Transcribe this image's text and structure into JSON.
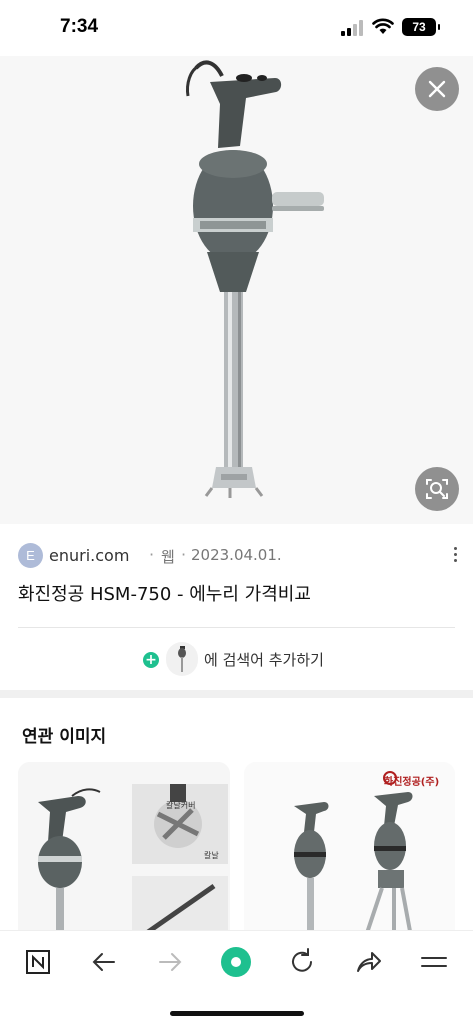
{
  "status_bar": {
    "time": "7:34",
    "battery_level": "73",
    "icons": [
      "signal-icon",
      "wifi-icon",
      "battery-icon"
    ]
  },
  "viewer": {
    "close_icon": "close-icon",
    "lens_icon": "image-search-icon"
  },
  "result": {
    "favicon_letter": "E",
    "domain": "enuri.com",
    "separator": "·",
    "type": "웹",
    "date": "2023.04.01.",
    "title": "화진정공 HSM-750 - 에누리 가격비교",
    "more_icon": "more-vertical-icon"
  },
  "add_search": {
    "label": "에 검색어 추가하기",
    "icon": "plus-icon"
  },
  "related": {
    "title": "연관 이미지",
    "cards": [
      {
        "label_a": "칼날커버",
        "label_b": "칼날"
      },
      {
        "brand": "화진정공(주)"
      }
    ]
  },
  "bottom_nav": {
    "items": [
      "naver-home-icon",
      "back-icon",
      "forward-icon",
      "green-dot-icon",
      "refresh-icon",
      "share-icon",
      "menu-icon"
    ]
  },
  "colors": {
    "accent_green": "#1ec08f",
    "overlay_button": "#6e6e6e"
  }
}
